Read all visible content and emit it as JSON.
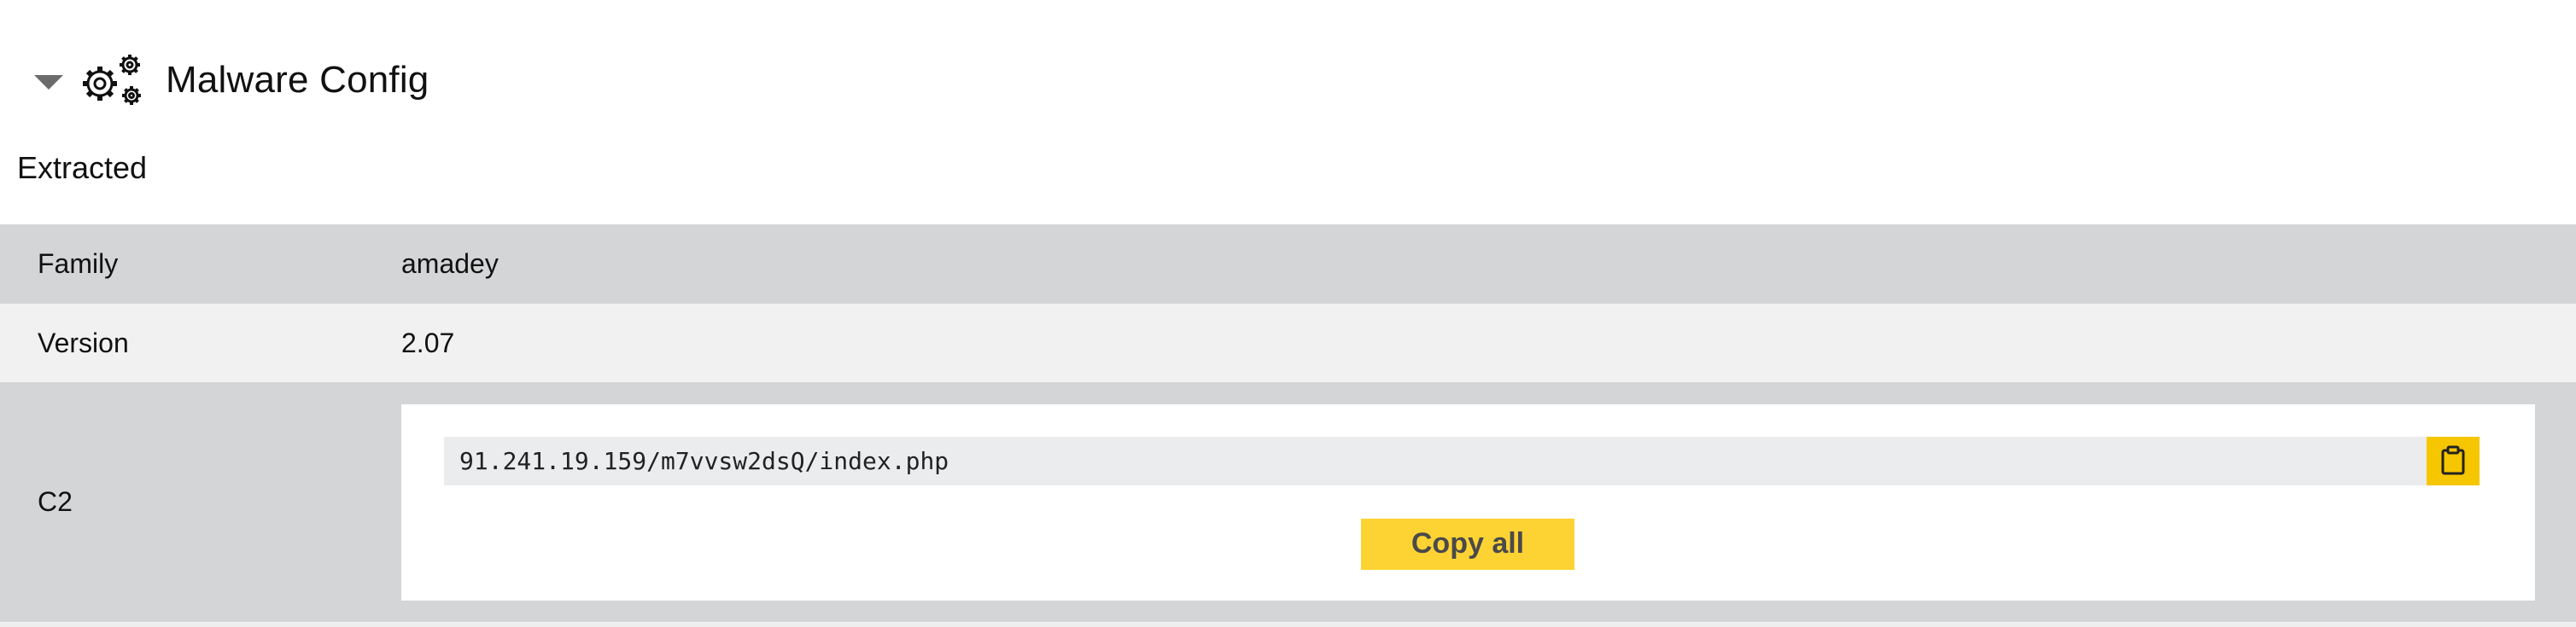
{
  "section": {
    "title": "Malware Config",
    "subtitle": "Extracted",
    "icons": {
      "toggle": "caret-down-icon",
      "section": "gears-icon"
    }
  },
  "config": {
    "rows": [
      {
        "key": "Family",
        "value": "amadey"
      },
      {
        "key": "Version",
        "value": "2.07"
      },
      {
        "key": "C2",
        "entries": [
          "91.241.19.159/m7vvsw2dsQ/index.php"
        ]
      }
    ],
    "copy_icon": "clipboard-icon",
    "copy_all_label": "Copy all"
  },
  "colors": {
    "row_dark": "#d4d5d6",
    "row_light": "#f1f1f1",
    "accent": "#fdd333",
    "accent_dark": "#f6c600",
    "entry_bg": "#ebecee"
  }
}
